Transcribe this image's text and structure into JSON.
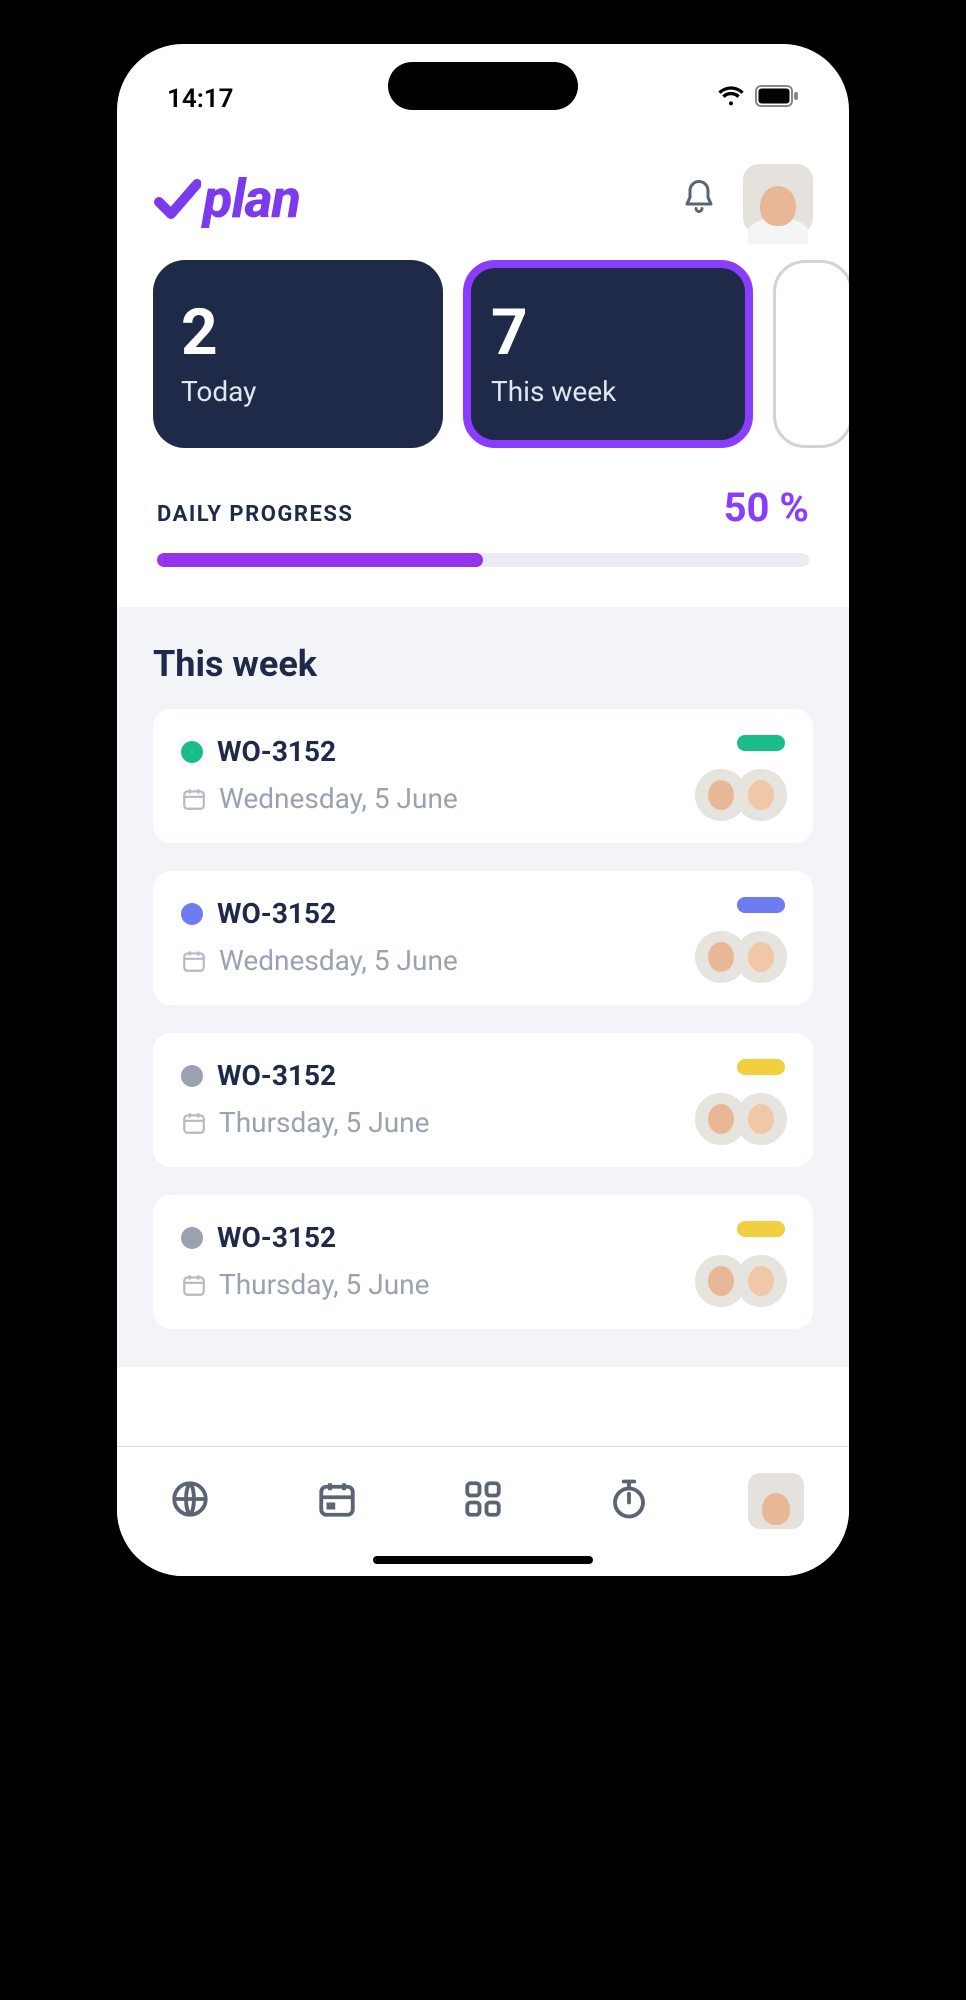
{
  "status": {
    "time": "14:17"
  },
  "header": {
    "brand": "plan"
  },
  "cards": [
    {
      "value": "2",
      "label": "Today",
      "active": false
    },
    {
      "value": "7",
      "label": "This week",
      "active": true
    }
  ],
  "progress": {
    "title": "DAILY PROGRESS",
    "percent_label": "50 %",
    "percent": 50
  },
  "list": {
    "heading": "This week",
    "items": [
      {
        "id": "WO-3152",
        "date": "Wednesday, 5 June",
        "color": "#1abc8a"
      },
      {
        "id": "WO-3152",
        "date": "Wednesday, 5 June",
        "color": "#6d7cf0"
      },
      {
        "id": "WO-3152",
        "date": "Thursday, 5 June",
        "color": "#9aa1b0",
        "pill": "#f2cf3f"
      },
      {
        "id": "WO-3152",
        "date": "Thursday, 5 June",
        "color": "#9aa1b0",
        "pill": "#f2cf3f"
      }
    ]
  },
  "colors": {
    "navy": "#1e2a47",
    "purple": "#8b3dff",
    "purple_fill": "#9333ea"
  }
}
